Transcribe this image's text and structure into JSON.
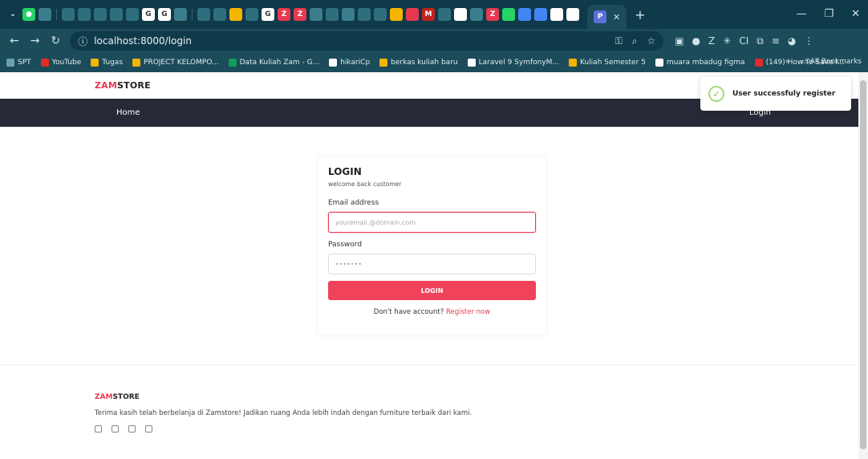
{
  "browser": {
    "active_tab_icon": "P",
    "new_tab": "+",
    "url": "localhost:8000/login",
    "bookmarks": [
      {
        "label": "SPT",
        "color": "#6aa0b0"
      },
      {
        "label": "YouTube",
        "color": "#e02b2b"
      },
      {
        "label": "Tugas",
        "color": "#f4b400"
      },
      {
        "label": "PROJECT KELOMPO...",
        "color": "#f4b400"
      },
      {
        "label": "Data Kuliah Zam - G...",
        "color": "#0f9d58"
      },
      {
        "label": "hikariCp",
        "color": "#ffffff"
      },
      {
        "label": "berkas kuliah baru",
        "color": "#f4b400"
      },
      {
        "label": "Laravel 9 SymfonyM...",
        "color": "#ffffff"
      },
      {
        "label": "Kuliah Semester 5",
        "color": "#f4b400"
      },
      {
        "label": "muara mbadug figma",
        "color": "#ffffff"
      },
      {
        "label": "(149) How To Save I...",
        "color": "#e02b2b"
      }
    ],
    "more_bookmarks": "»",
    "all_bookmarks": "All Bookmarks"
  },
  "site": {
    "brand_prefix": "ZAM",
    "brand_suffix": "STORE",
    "nav_home": "Home",
    "nav_login": "Login"
  },
  "toast": {
    "message": "User successfuly register"
  },
  "login_card": {
    "title": "LOGIN",
    "subtitle": "welcome back customer",
    "email_label": "Email address",
    "email_placeholder": "youremail.@domain.com",
    "password_label": "Password",
    "password_placeholder": "•••••••",
    "button": "LOGIN",
    "register_text": "Don't have account?",
    "register_link": "Register now"
  },
  "footer": {
    "brand_prefix": "ZAM",
    "brand_suffix": "STORE",
    "text": "Terima kasih telah berbelanja di Zamstore! Jadikan ruang Anda lebih indah dengan furniture terbaik dari kami."
  },
  "colors": {
    "accent": "#e8384f",
    "navbar": "#262a36",
    "chrome": "#1c4b5a"
  }
}
